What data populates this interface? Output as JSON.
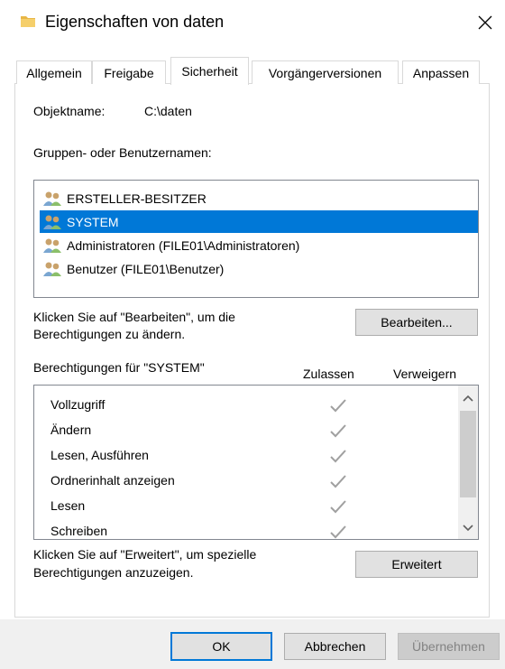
{
  "window": {
    "title": "Eigenschaften von daten",
    "close_glyph": "✕"
  },
  "tabs": [
    {
      "label": "Allgemein"
    },
    {
      "label": "Freigabe"
    },
    {
      "label": "Sicherheit"
    },
    {
      "label": "Vorgängerversionen"
    },
    {
      "label": "Anpassen"
    }
  ],
  "object": {
    "label": "Objektname:",
    "value": "C:\\daten"
  },
  "groups": {
    "label": "Gruppen- oder Benutzernamen:",
    "items": [
      {
        "name": "ERSTELLER-BESITZER"
      },
      {
        "name": "SYSTEM"
      },
      {
        "name": "Administratoren (FILE01\\Administratoren)"
      },
      {
        "name": "Benutzer (FILE01\\Benutzer)"
      }
    ],
    "selected_index": 1
  },
  "edit": {
    "hint_line1": "Klicken Sie auf \"Bearbeiten\", um die",
    "hint_line2": "Berechtigungen zu ändern.",
    "button": "Bearbeiten..."
  },
  "permissions": {
    "label": "Berechtigungen für \"SYSTEM\"",
    "allow_header": "Zulassen",
    "deny_header": "Verweigern",
    "rows": [
      {
        "name": "Vollzugriff",
        "allow": true,
        "deny": false
      },
      {
        "name": "Ändern",
        "allow": true,
        "deny": false
      },
      {
        "name": "Lesen, Ausführen",
        "allow": true,
        "deny": false
      },
      {
        "name": "Ordnerinhalt anzeigen",
        "allow": true,
        "deny": false
      },
      {
        "name": "Lesen",
        "allow": true,
        "deny": false
      },
      {
        "name": "Schreiben",
        "allow": true,
        "deny": false
      }
    ]
  },
  "advanced": {
    "hint_line1": "Klicken Sie auf \"Erweitert\", um spezielle",
    "hint_line2": "Berechtigungen anzuzeigen.",
    "button": "Erweitert"
  },
  "footer": {
    "ok": "OK",
    "cancel": "Abbrechen",
    "apply": "Übernehmen"
  },
  "colors": {
    "selection": "#0078d7",
    "folder": "#e8b645",
    "check": "#a0a0a0"
  }
}
